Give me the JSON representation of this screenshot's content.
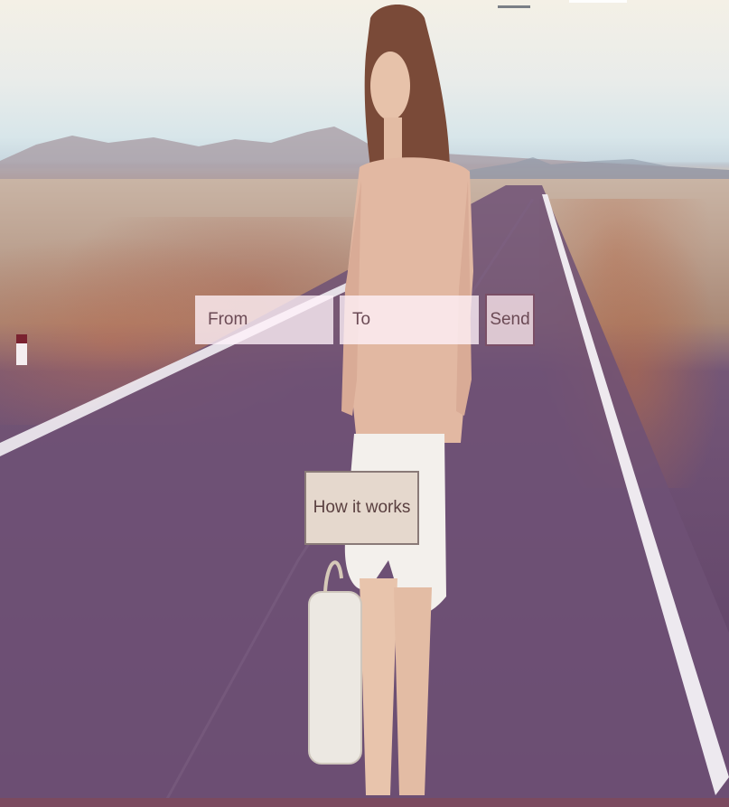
{
  "header": {
    "logo_text": ""
  },
  "search": {
    "from_placeholder": "From",
    "to_placeholder": "To",
    "send_label": "Send"
  },
  "cta": {
    "how_it_works_label": "How it works"
  },
  "colors": {
    "field_bg": "#fff2fa",
    "button_border": "#7a4f66",
    "text": "#6b4a55",
    "cta_bg": "#e5d8cd",
    "bottom_strip": "#7b4a5f"
  }
}
